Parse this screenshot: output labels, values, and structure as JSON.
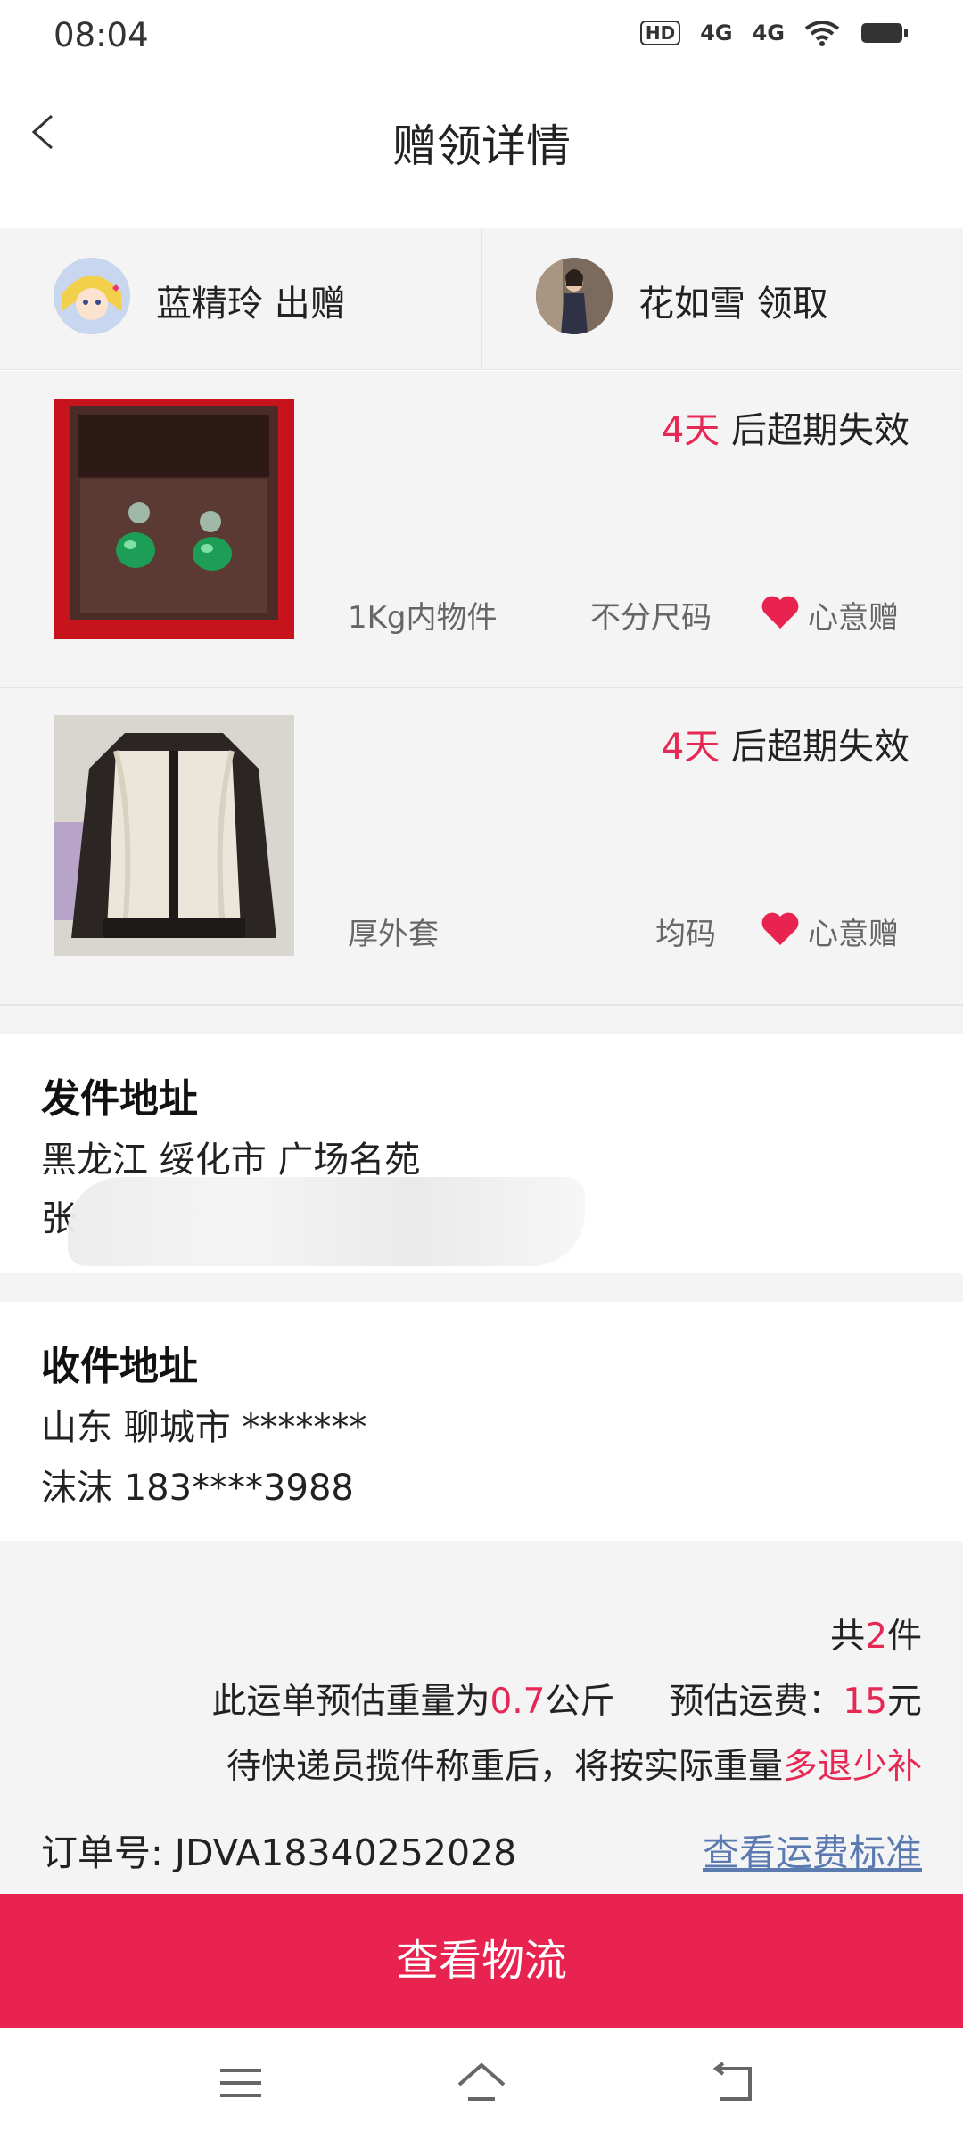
{
  "status_bar": {
    "time": "08:04",
    "icons": [
      "hd-icon",
      "signal-4g-icon",
      "signal-4g-icon",
      "wifi-icon",
      "battery-icon"
    ],
    "labels": [
      "HD",
      "4G",
      "4G"
    ]
  },
  "header": {
    "title": "赠领详情",
    "back_icon": "chevron-left-icon"
  },
  "users": {
    "giver": {
      "label": "蓝精玲 出赠"
    },
    "receiver": {
      "label": "花如雪 领取"
    }
  },
  "items": [
    {
      "expire_days": "4天",
      "expire_suffix": " 后超期失效",
      "weight": "1Kg内物件",
      "size": "不分尺码",
      "gift_type": "心意赠"
    },
    {
      "expire_days": "4天",
      "expire_suffix": " 后超期失效",
      "weight": "厚外套",
      "size": "均码",
      "gift_type": "心意赠"
    }
  ],
  "send_address": {
    "title": "发件地址",
    "line1": "黑龙江 绥化市 广场名苑",
    "line2": "张"
  },
  "receive_address": {
    "title": "收件地址",
    "line1": "山东 聊城市 *******",
    "line2": "沫沫 183****3988"
  },
  "summary": {
    "count_prefix": "共",
    "count": "2",
    "count_suffix": "件",
    "weight_prefix": "此运单预估重量为",
    "weight": "0.7",
    "weight_unit": "公斤",
    "fee_prefix": "预估运费：",
    "fee": "15",
    "fee_unit": "元",
    "note_prefix": "待快递员揽件称重后，将按实际重量",
    "note_highlight": "多退少补",
    "order_label": "订单号:",
    "order_no": "JDVA18340252028",
    "fee_link": "查看运费标准"
  },
  "actions": {
    "logistics": "查看物流"
  },
  "colors": {
    "accent": "#e8234f",
    "highlight": "#e62855",
    "link": "#5a7ab0",
    "bg_gray": "#f4f4f4"
  }
}
